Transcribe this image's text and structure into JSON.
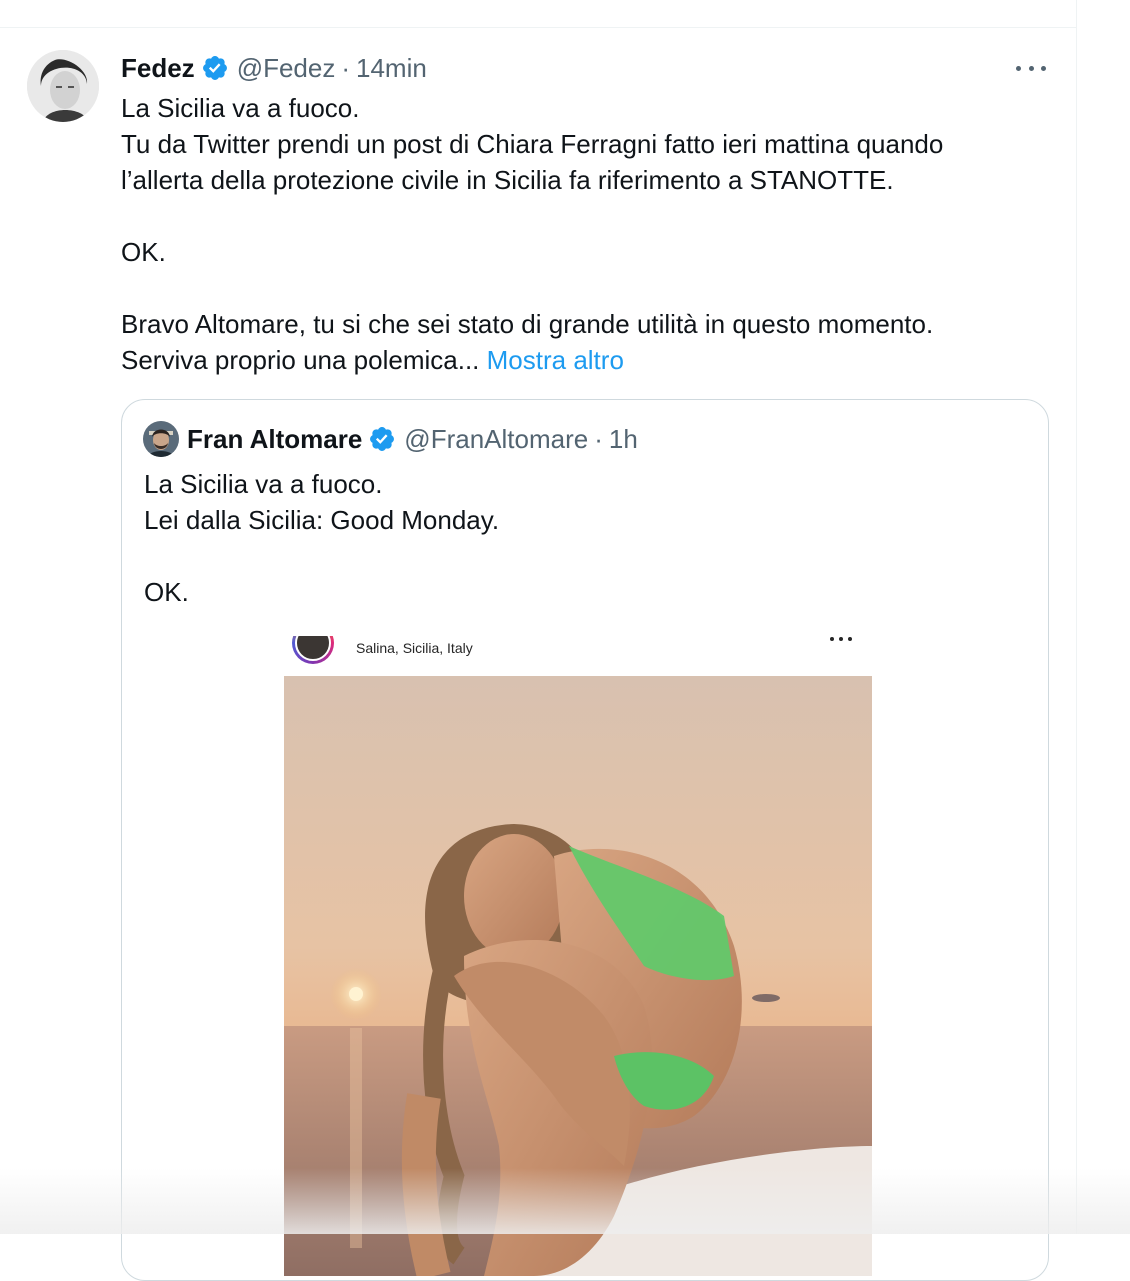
{
  "tweet": {
    "author_name": "Fedez",
    "author_handle": "@Fedez",
    "separator": "·",
    "time": "14min",
    "lines": [
      "La Sicilia va a fuoco.",
      "Tu da Twitter prendi un post di Chiara Ferragni fatto ieri mattina quando",
      "l’allerta della protezione civile in Sicilia fa riferimento a STANOTTE.",
      "",
      "OK.",
      "",
      "Bravo Altomare, tu si che sei stato di grande utilità in questo momento."
    ],
    "last_line_text": "Serviva proprio una polemica...",
    "show_more": "Mostra altro",
    "more_icon": "more-horizontal-icon",
    "verified_icon": "verified-badge-icon",
    "verified_color": "#1d9bf0"
  },
  "quoted": {
    "author_name": "Fran Altomare",
    "author_handle": "@FranAltomare",
    "separator": "·",
    "time": "1h",
    "lines": [
      "La Sicilia va a fuoco.",
      "Lei dalla Sicilia: Good Monday.",
      "",
      "OK."
    ],
    "media": {
      "location": "Salina, Sicilia, Italy",
      "more_icon": "more-horizontal-icon"
    }
  },
  "colors": {
    "text": "#0f1419",
    "muted": "#536471",
    "link": "#1d9bf0",
    "border": "#cfd9de"
  }
}
